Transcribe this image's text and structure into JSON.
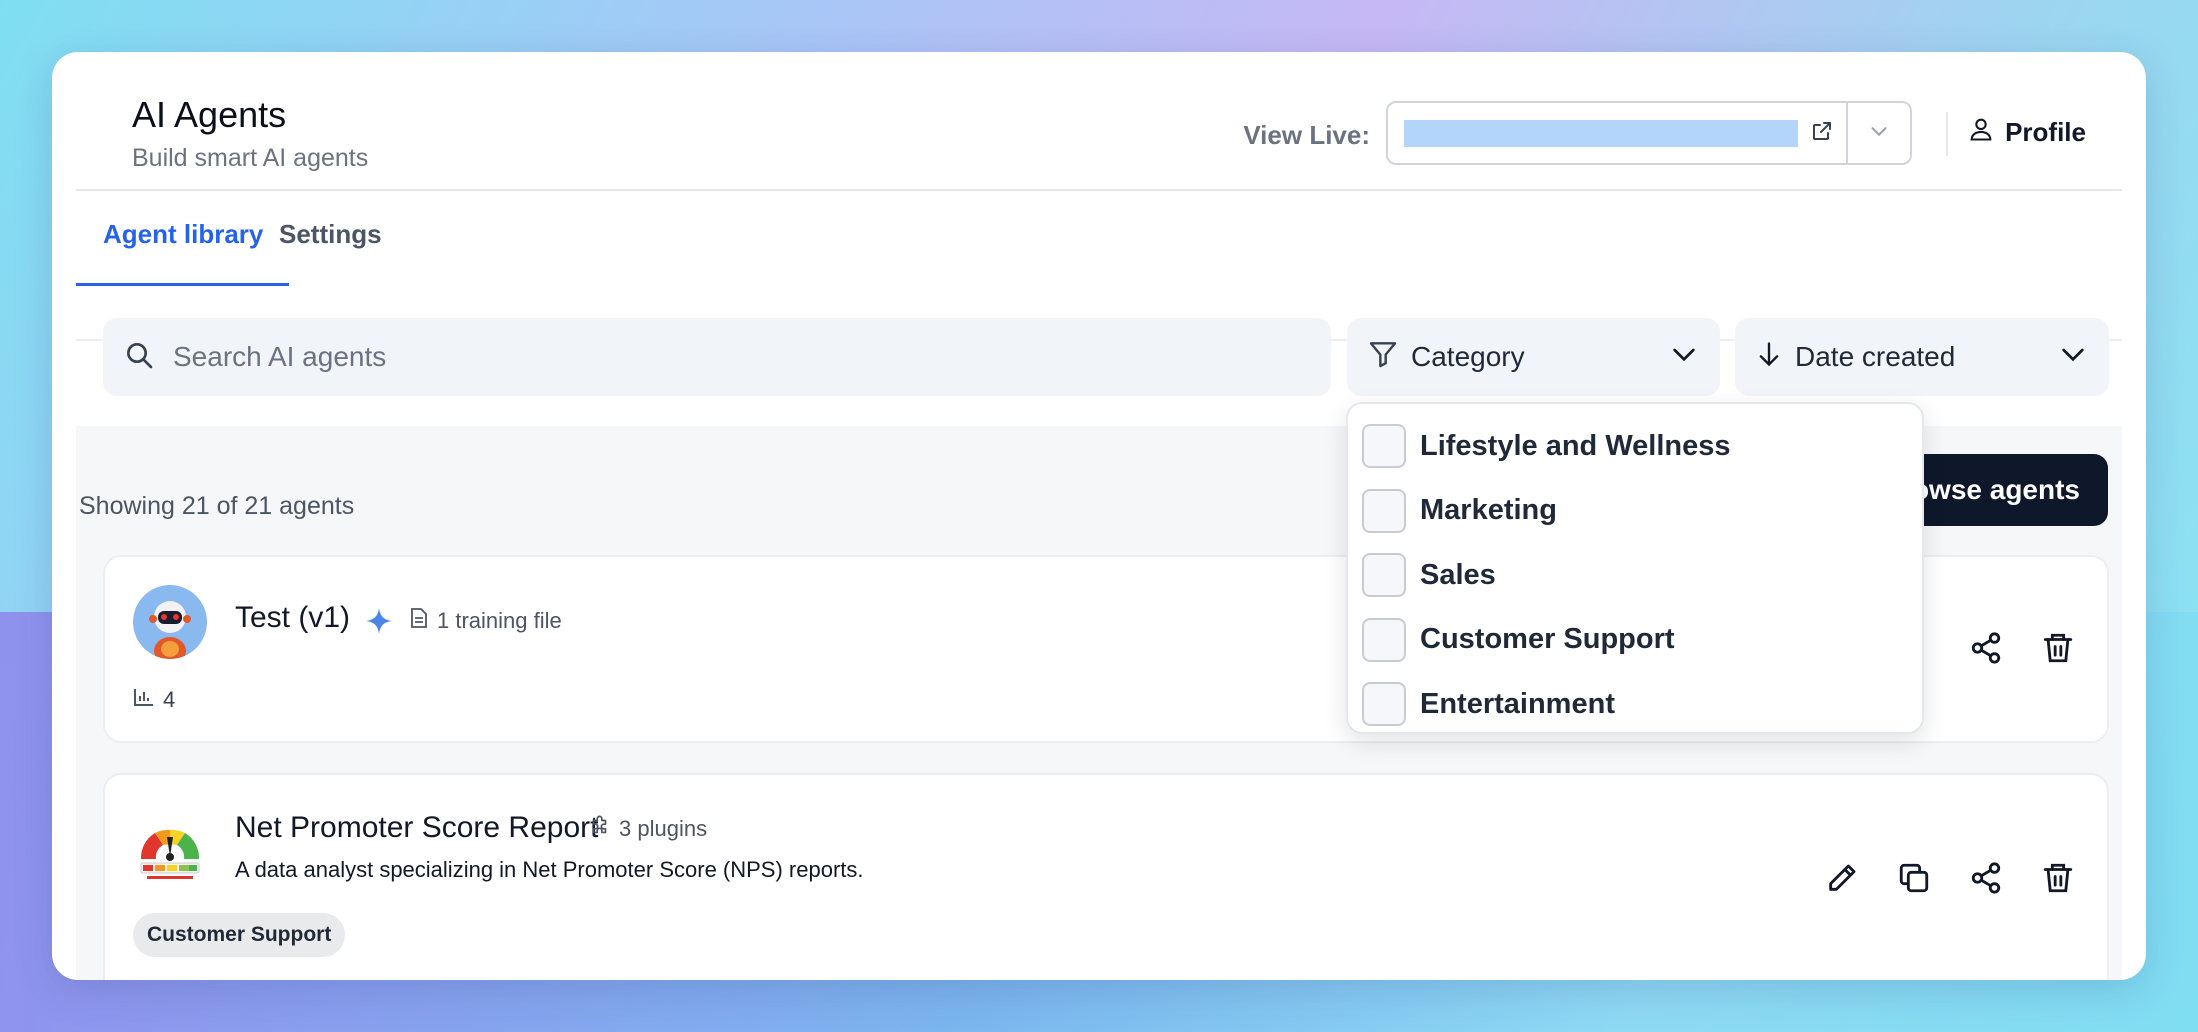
{
  "header": {
    "title": "AI Agents",
    "subtitle": "Build smart AI agents",
    "view_live_label": "View Live:",
    "profile_label": "Profile"
  },
  "tabs": [
    {
      "label": "Agent library",
      "active": true
    },
    {
      "label": "Settings",
      "active": false
    }
  ],
  "toolbar": {
    "search_placeholder": "Search AI agents",
    "category_label": "Category",
    "sort_label": "Date created"
  },
  "category_menu": {
    "options": [
      "Lifestyle and Wellness",
      "Marketing",
      "Sales",
      "Customer Support",
      "Entertainment"
    ]
  },
  "list": {
    "showing_text": "Showing 21 of 21 agents",
    "browse_label": "Browse agents"
  },
  "agents": [
    {
      "name": "Test (v1)",
      "training_files": "1 training file",
      "stat_count": "4"
    },
    {
      "name": "Net Promoter Score Report",
      "plugins": "3 plugins",
      "description": "A data analyst specializing in Net Promoter Score (NPS) reports.",
      "tag": "Customer Support"
    }
  ],
  "colors": {
    "accent": "#2563eb",
    "dark_button": "#0f172a",
    "sparkle": "#4a86e8"
  }
}
